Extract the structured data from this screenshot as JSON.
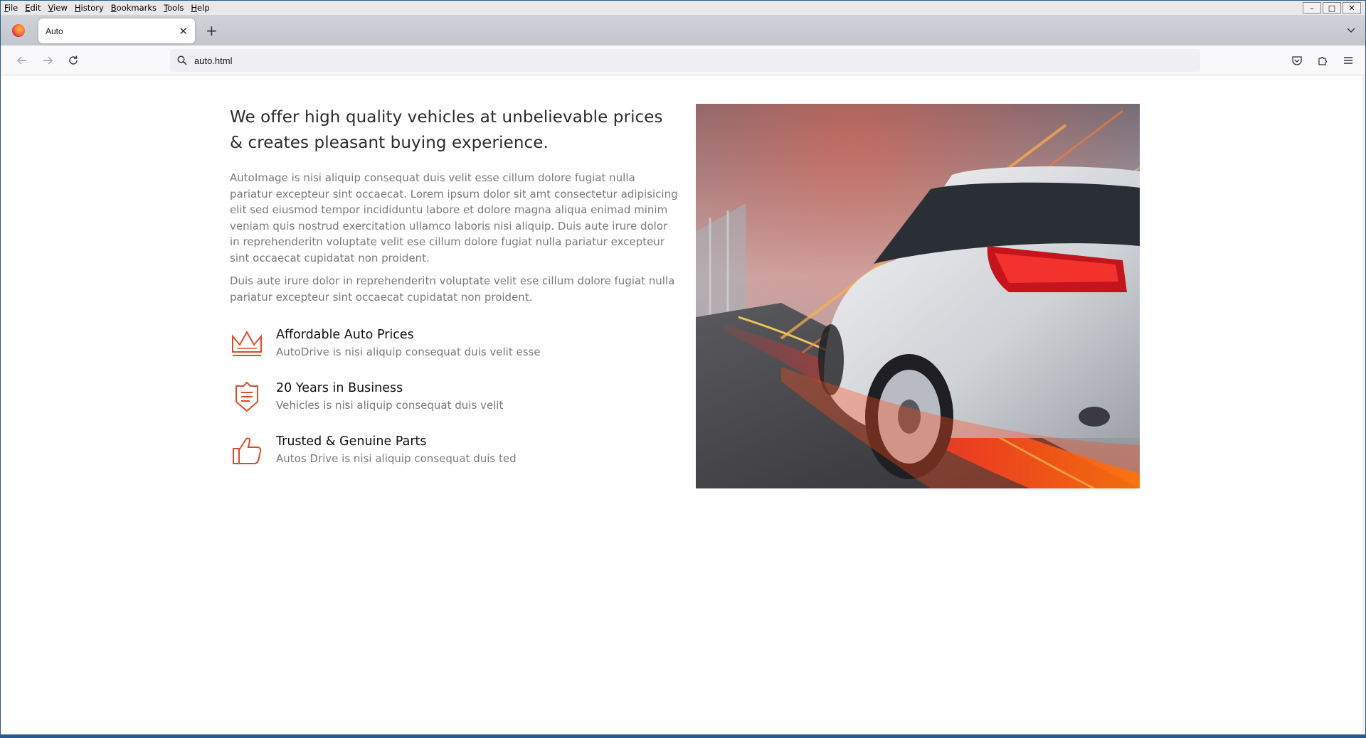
{
  "menubar": {
    "items": [
      {
        "key": "F",
        "rest": "ile"
      },
      {
        "key": "E",
        "rest": "dit"
      },
      {
        "key": "V",
        "rest": "iew"
      },
      {
        "key": "H",
        "rest": "istory"
      },
      {
        "key": "B",
        "rest": "ookmarks"
      },
      {
        "key": "T",
        "rest": "ools"
      },
      {
        "key": "H",
        "rest": "elp"
      }
    ]
  },
  "window_controls": {
    "minimize": "–",
    "maximize": "□",
    "close": "✕"
  },
  "tabs": {
    "active_title": "Auto",
    "close_glyph": "✕",
    "new_tab_glyph": "+"
  },
  "toolbar": {
    "url": "auto.html"
  },
  "content": {
    "headline": "We offer high quality vehicles at unbelievable prices & creates pleasant buying experience.",
    "paragraph_1": "AutoImage is nisi aliquip consequat duis velit esse cillum dolore fugiat nulla pariatur excepteur sint occaecat. Lorem ipsum dolor sit amt consectetur adipisicing elit sed eiusmod tempor incididuntu labore et dolore magna aliqua enimad minim veniam quis nostrud exercitation ullamco laboris nisi aliquip. Duis aute irure dolor in reprehenderitn voluptate velit ese cillum dolore fugiat nulla pariatur excepteur sint occaecat cupidatat non proident.",
    "paragraph_2": "Duis aute irure dolor in reprehenderitn voluptate velit ese cillum dolore fugiat nulla pariatur excepteur sint occaecat cupidatat non proident.",
    "features": [
      {
        "icon": "crown-icon",
        "title": "Affordable Auto Prices",
        "desc": "AutoDrive is nisi aliquip consequat duis velit esse"
      },
      {
        "icon": "shield-document-icon",
        "title": "20 Years in Business",
        "desc": "Vehicles is nisi aliquip consequat duis velit"
      },
      {
        "icon": "thumbs-up-icon",
        "title": "Trusted & Genuine Parts",
        "desc": "Autos Drive is nisi aliquip consequat duis ted"
      }
    ]
  },
  "colors": {
    "accent": "#e04a2a",
    "heading": "#2b2b2b",
    "body_text": "#7a7a7a"
  }
}
